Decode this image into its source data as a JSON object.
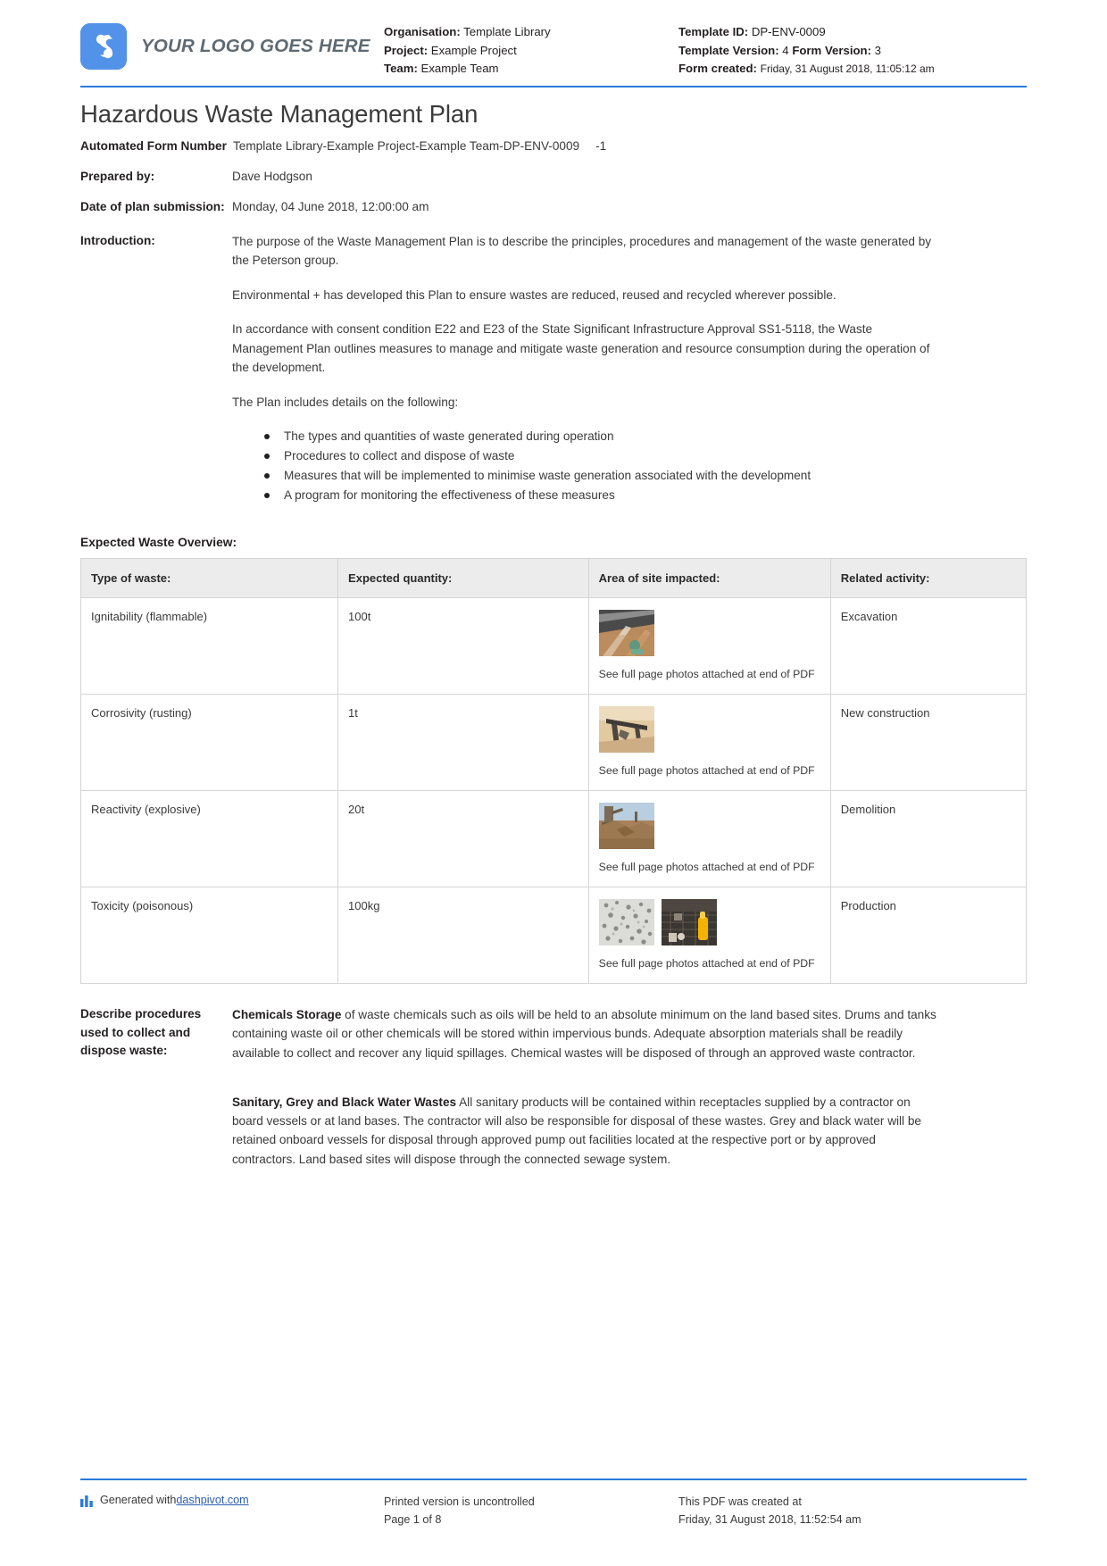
{
  "header": {
    "logo_text": "YOUR LOGO GOES HERE",
    "left_meta": [
      {
        "label": "Organisation:",
        "value": "Template Library"
      },
      {
        "label": "Project:",
        "value": "Example Project"
      },
      {
        "label": "Team:",
        "value": "Example Team"
      }
    ],
    "right_meta": {
      "template_id_label": "Template ID:",
      "template_id_value": "DP-ENV-0009",
      "template_version_label": "Template Version:",
      "template_version_value": "4",
      "form_version_label": "Form Version:",
      "form_version_value": "3",
      "form_created_label": "Form created:",
      "form_created_value": "Friday, 31 August 2018, 11:05:12 am"
    }
  },
  "title": "Hazardous Waste Management Plan",
  "fields": {
    "automated_form_number_label": "Automated Form Number",
    "automated_form_number_value": "Template Library-Example Project-Example Team-DP-ENV-0009",
    "automated_form_number_suffix": "-1",
    "prepared_by_label": "Prepared by:",
    "prepared_by_value": "Dave Hodgson",
    "date_label": "Date of plan submission:",
    "date_value": "Monday, 04 June 2018, 12:00:00 am",
    "introduction_label": "Introduction:",
    "introduction_paragraphs": [
      "The purpose of the Waste Management Plan is to describe the principles, procedures and management of the waste generated by the Peterson group.",
      "Environmental + has developed this Plan to ensure wastes are reduced, reused and recycled wherever possible.",
      "In accordance with consent condition E22 and E23 of the State Significant Infrastructure Approval SS1-5118, the Waste Management Plan outlines measures to manage and mitigate waste generation and resource consumption during the operation of the development.",
      "The Plan includes details on the following:"
    ],
    "introduction_bullets": [
      "The types and quantities of waste generated during operation",
      "Procedures to collect and dispose of waste",
      "Measures that will be implemented to minimise waste generation associated with the development",
      "A program for monitoring the effectiveness of these measures"
    ]
  },
  "waste_overview": {
    "section_label": "Expected Waste Overview:",
    "columns": [
      "Type of waste:",
      "Expected quantity:",
      "Area of site impacted:",
      "Related activity:"
    ],
    "photo_caption": "See full page photos attached at end of PDF",
    "rows": [
      {
        "type": "Ignitability (flammable)",
        "quantity": "100t",
        "photos": 1,
        "activity": "Excavation"
      },
      {
        "type": "Corrosivity (rusting)",
        "quantity": "1t",
        "photos": 1,
        "activity": "New construction"
      },
      {
        "type": "Reactivity (explosive)",
        "quantity": "20t",
        "photos": 1,
        "activity": "Demolition"
      },
      {
        "type": "Toxicity (poisonous)",
        "quantity": "100kg",
        "photos": 2,
        "activity": "Production"
      }
    ]
  },
  "procedures": {
    "label": "Describe procedures used to collect and dispose waste:",
    "paragraph_1_bold": "Chemicals Storage",
    "paragraph_1_rest": " of waste chemicals such as oils will be held to an absolute minimum on the land based sites. Drums and tanks containing waste oil or other chemicals will be stored within impervious bunds. Adequate absorption materials shall be readily available to collect and recover any liquid spillages. Chemical wastes will be disposed of through an approved waste contractor.",
    "paragraph_2_bold": "Sanitary, Grey and Black Water Wastes",
    "paragraph_2_rest": " All sanitary products will be contained within receptacles supplied by a contractor on board vessels or at land bases. The contractor will also be responsible for disposal of these wastes. Grey and black water will be retained onboard vessels for disposal through approved pump out facilities located at the respective port or by approved contractors. Land based sites will dispose through the connected sewage system."
  },
  "footer": {
    "generated_prefix": "Generated with ",
    "generated_link": "dashpivot.com",
    "printed_line_1": "Printed version is uncontrolled",
    "printed_line_2": "Page 1 of 8",
    "created_line_1": "This PDF was created at",
    "created_line_2": "Friday, 31 August 2018, 11:52:54 am"
  },
  "colors": {
    "accent_blue": "#2a7ade",
    "logo_blue": "#5292e8",
    "table_header_gray": "#ececec",
    "link_blue": "#2a5db0"
  }
}
